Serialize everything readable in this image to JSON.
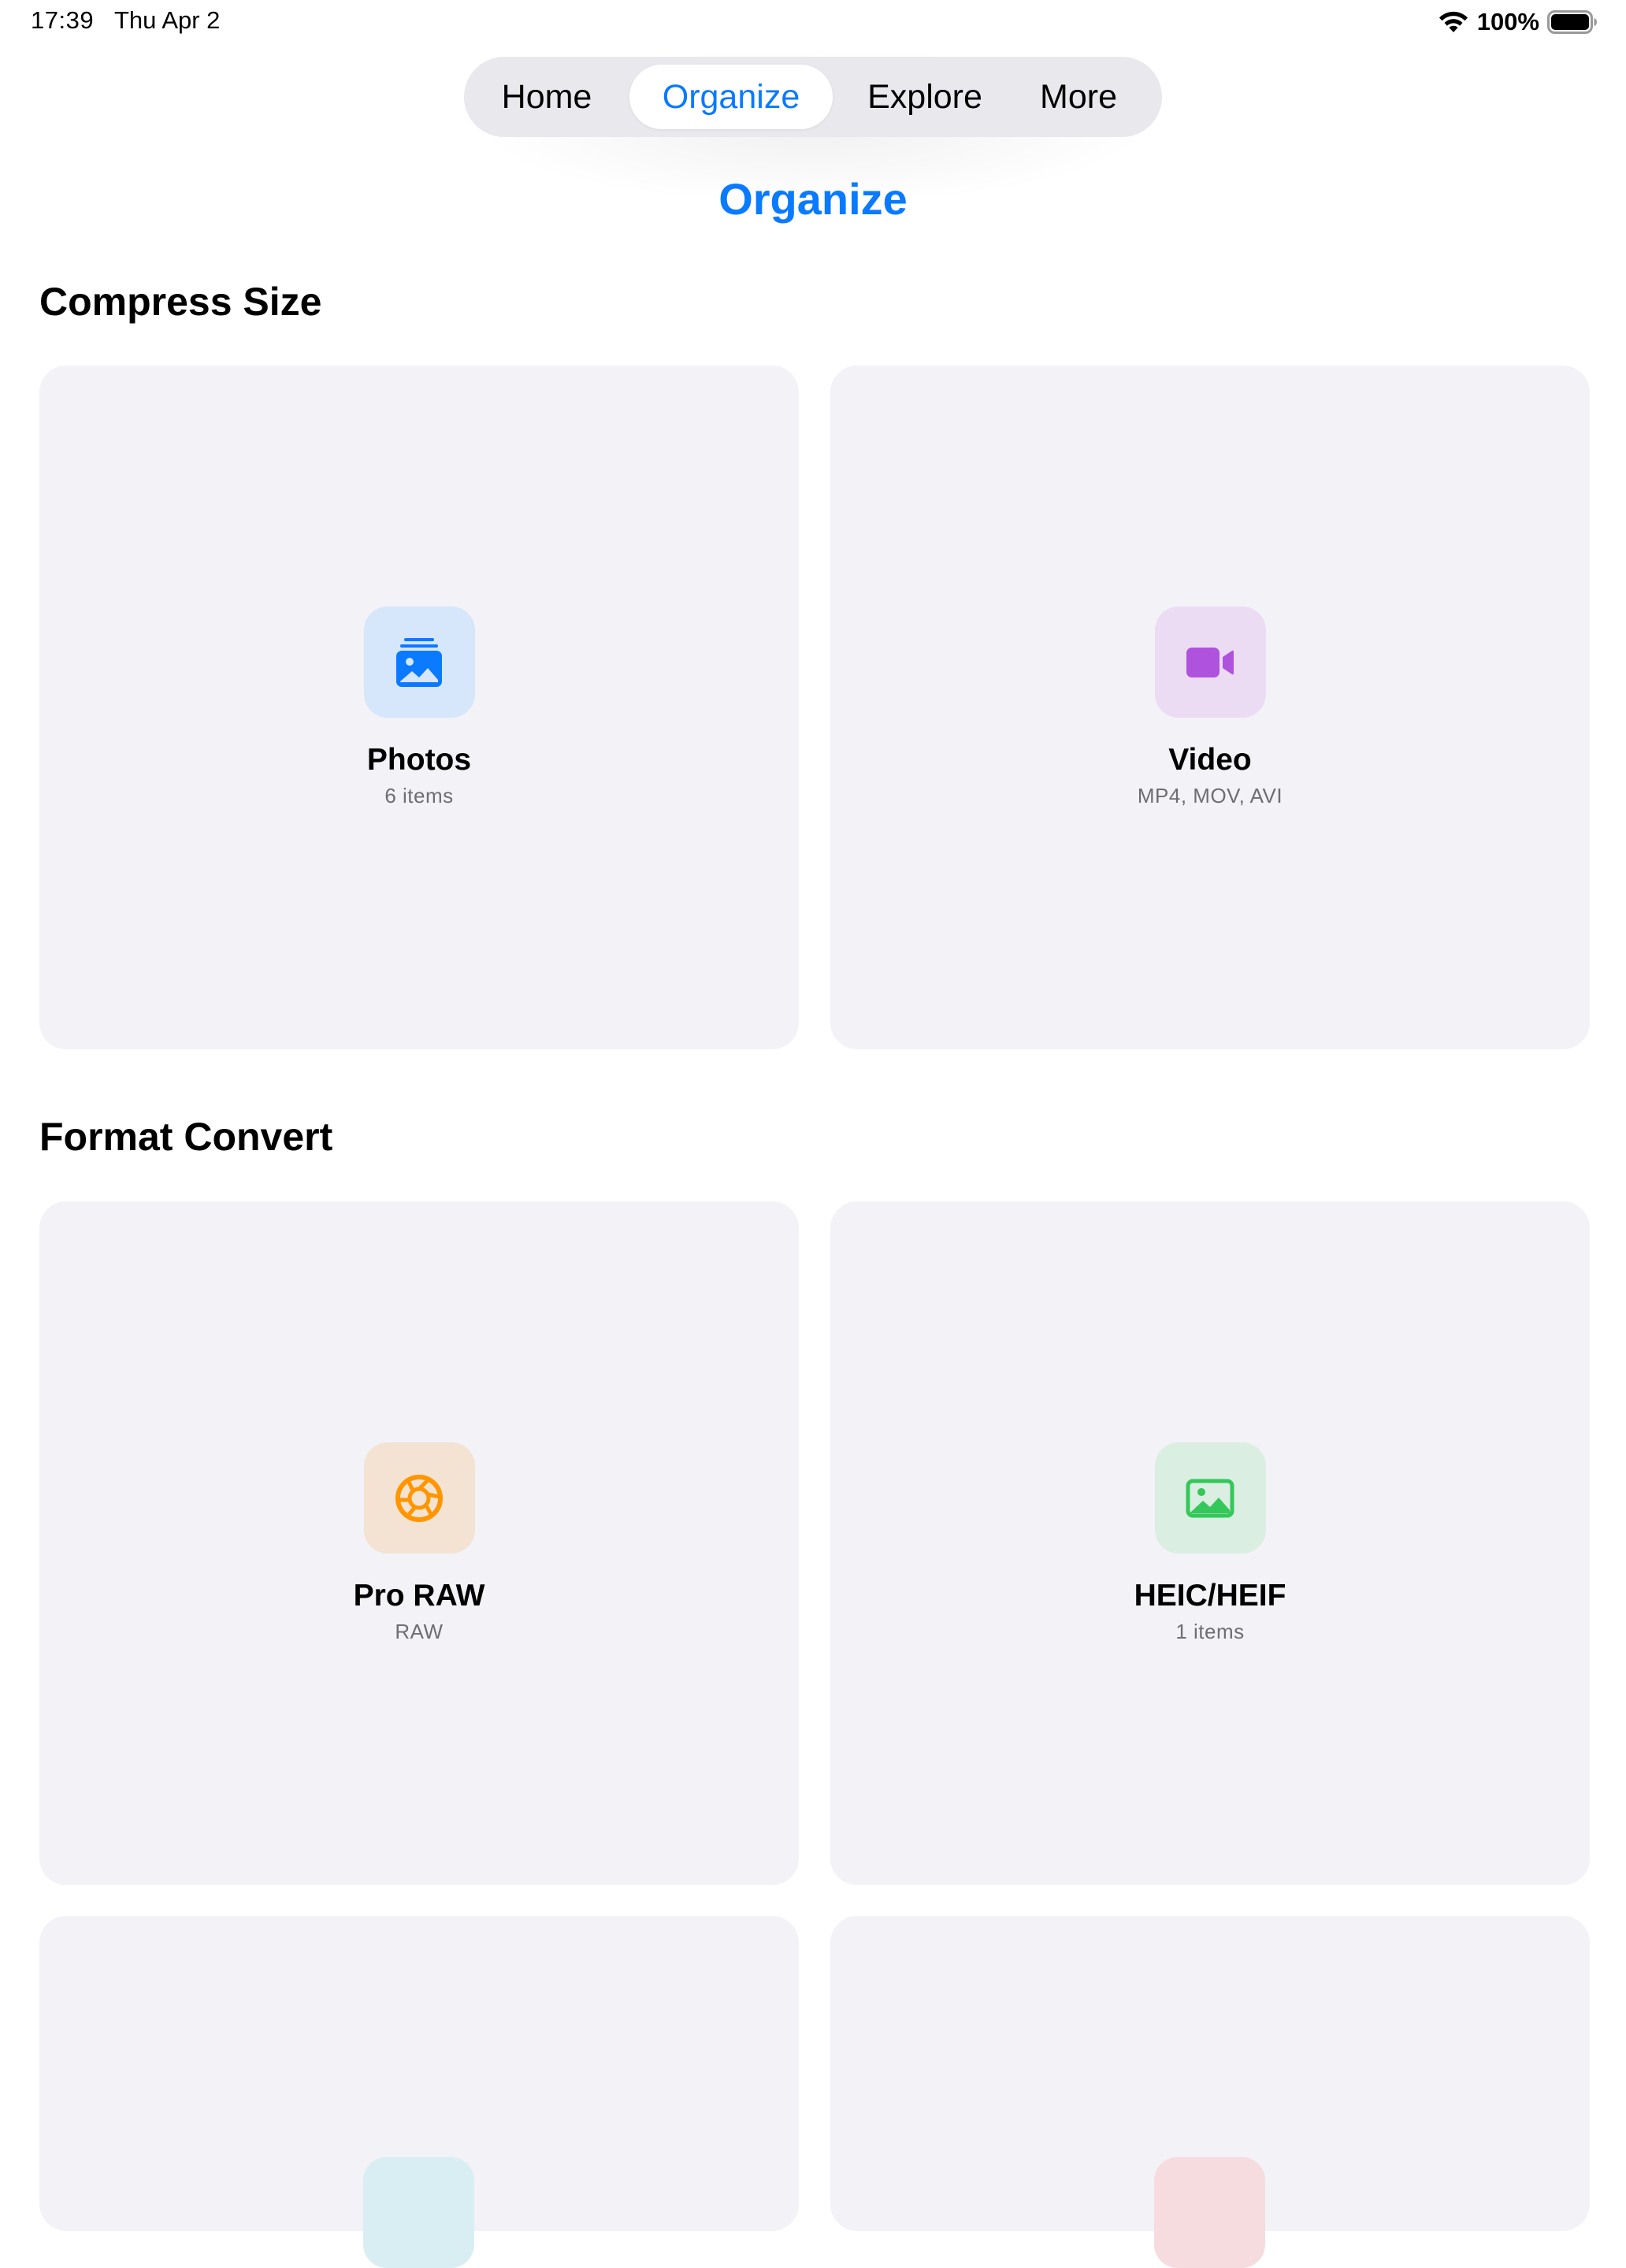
{
  "status_bar": {
    "time": "17:39",
    "date": "Thu Apr 2",
    "battery_percent": "100%",
    "battery_level": 1.0,
    "wifi_icon": "wifi-icon",
    "battery_icon": "battery-full-icon"
  },
  "tabs": [
    {
      "label": "Home",
      "active": false
    },
    {
      "label": "Organize",
      "active": true
    },
    {
      "label": "Explore",
      "active": false
    },
    {
      "label": "More",
      "active": false
    }
  ],
  "page_title": "Organize",
  "accent_color": "#0a7aff",
  "sections": [
    {
      "title": "Compress Size",
      "cards": [
        {
          "title": "Photos",
          "subtitle": "6 items",
          "icon": "photos-stack-icon",
          "icon_color": "#0a7aff",
          "tile_color": "#d6e6fb"
        },
        {
          "title": "Video",
          "subtitle": "MP4, MOV, AVI",
          "icon": "video-camera-icon",
          "icon_color": "#af52de",
          "tile_color": "#ebdcf3"
        }
      ]
    },
    {
      "title": "Format Convert",
      "cards": [
        {
          "title": "Pro RAW",
          "subtitle": "RAW",
          "icon": "aperture-icon",
          "icon_color": "#ff9500",
          "tile_color": "#f4e3d2"
        },
        {
          "title": "HEIC/HEIF",
          "subtitle": "1 items",
          "icon": "photo-icon",
          "icon_color": "#34c759",
          "tile_color": "#dbeee2"
        },
        {
          "title": "",
          "subtitle": "",
          "icon": "",
          "icon_color": "",
          "tile_color": "#d9eef2"
        },
        {
          "title": "",
          "subtitle": "",
          "icon": "",
          "icon_color": "",
          "tile_color": "#f6dcdf"
        }
      ]
    }
  ]
}
